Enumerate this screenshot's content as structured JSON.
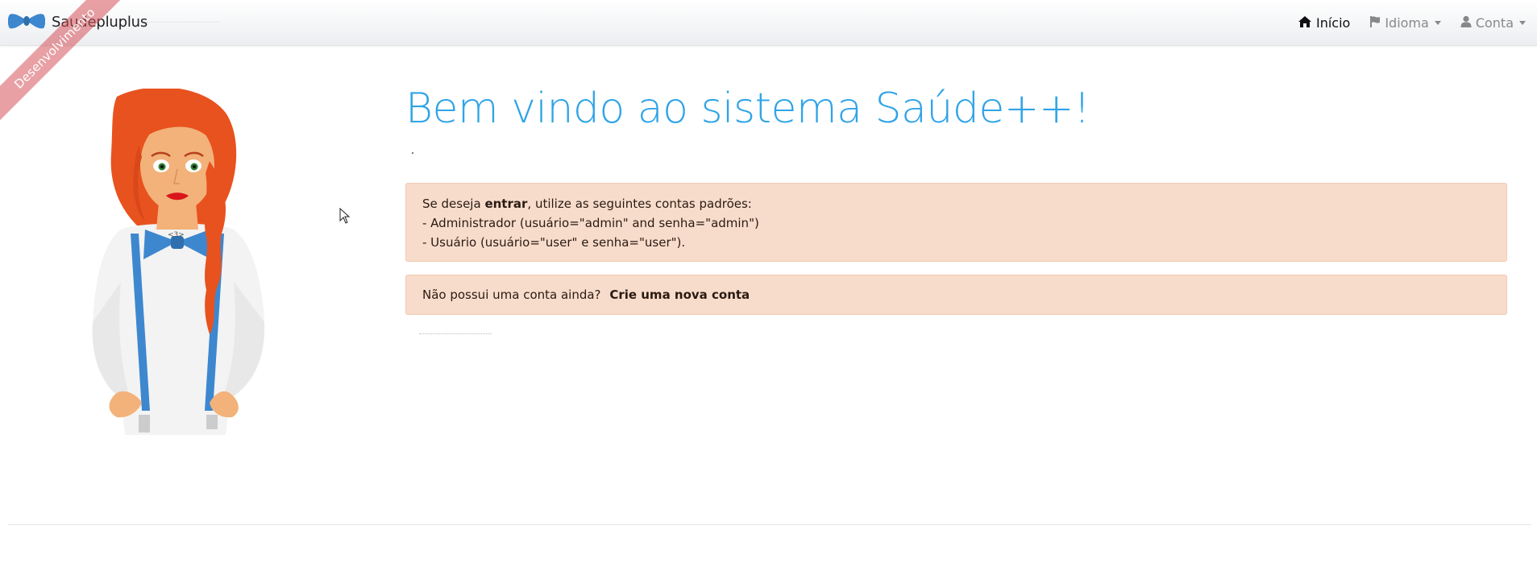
{
  "brand": {
    "name": "Saudepluplus"
  },
  "ribbon": {
    "label": "Desenvolvimento"
  },
  "nav": {
    "home": "Início",
    "language": "Idioma",
    "account": "Conta"
  },
  "main": {
    "title": "Bem vindo ao sistema Saúde++!",
    "alert_login": {
      "prefix": "Se deseja ",
      "strong": "entrar",
      "suffix": ", utilize as seguintes contas padrões:",
      "line_admin": "- Administrador (usuário=\"admin\" and senha=\"admin\")",
      "line_user": "- Usuário (usuário=\"user\" e senha=\"user\")."
    },
    "alert_register": {
      "text": "Não possui uma conta ainda?",
      "link": "Crie uma nova conta"
    }
  },
  "colors": {
    "title": "#2fa4e7",
    "alert_bg": "#f8dccb",
    "ribbon": "#d6525a",
    "hair": "#e8521e",
    "bowtie": "#3d87cf"
  },
  "icons": {
    "home": "home-icon",
    "language": "flag-icon",
    "account": "user-icon",
    "brand": "bowtie-logo-icon"
  }
}
